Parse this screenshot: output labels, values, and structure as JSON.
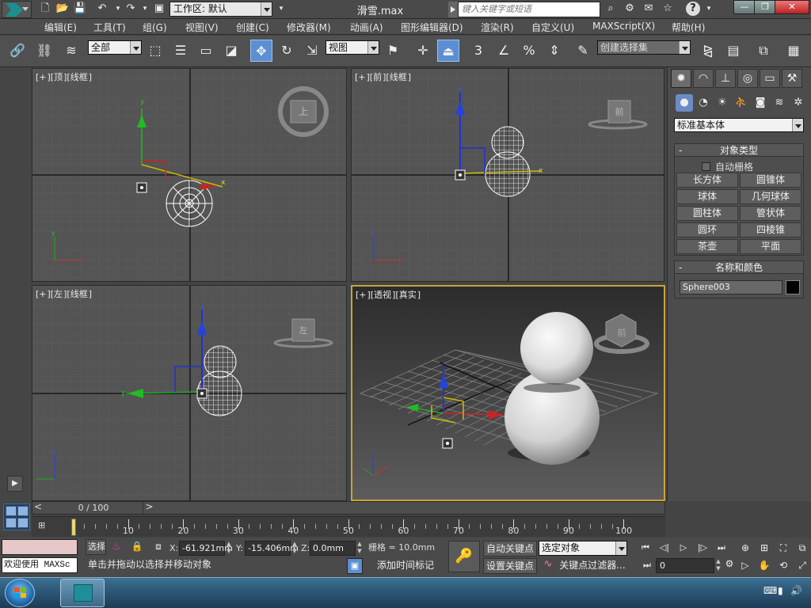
{
  "app": {
    "workspace_label": "工作区: 默认",
    "file_title": "滑雪.max",
    "search_placeholder": "键入关键字或短语",
    "window_controls": {
      "minimize": "—",
      "restore": "❐",
      "close": "✕"
    }
  },
  "menu": {
    "items": [
      "编辑(E)",
      "工具(T)",
      "组(G)",
      "视图(V)",
      "创建(C)",
      "修改器(M)",
      "动画(A)",
      "图形编辑器(D)",
      "渲染(R)",
      "自定义(U)",
      "MAXScript(X)",
      "帮助(H)"
    ]
  },
  "toolbar": {
    "selection_filter": "全部",
    "ref_coord": "视图",
    "named_selection": "创建选择集",
    "snap_labels": {
      "snap": "3",
      "angle": "",
      "percent": "%"
    }
  },
  "viewports": [
    {
      "id": "top",
      "bracket": "+",
      "name": "顶",
      "shading": "线框",
      "viewcube_label": "上"
    },
    {
      "id": "front",
      "bracket": "+",
      "name": "前",
      "shading": "线框",
      "viewcube_label": "前"
    },
    {
      "id": "left",
      "bracket": "+",
      "name": "左",
      "shading": "线框",
      "viewcube_label": "左"
    },
    {
      "id": "persp",
      "bracket": "+",
      "name": "透视",
      "shading": "真实",
      "viewcube_label": "前"
    }
  ],
  "command_panel": {
    "category": "标准基本体",
    "object_type_title": "对象类型",
    "autogrid_label": "自动栅格",
    "object_buttons": [
      "长方体",
      "圆锥体",
      "球体",
      "几何球体",
      "圆柱体",
      "管状体",
      "圆环",
      "四棱锥",
      "茶壶",
      "平面"
    ],
    "name_color_title": "名称和颜色",
    "object_name": "Sphere003",
    "object_color": "#000000",
    "rollout_toggle": "-"
  },
  "timeline": {
    "frame_display": "0 / 100",
    "ticks": [
      "10",
      "20",
      "30",
      "40",
      "50",
      "60",
      "70",
      "80",
      "90",
      "100"
    ]
  },
  "status": {
    "listener_text": "欢迎使用 MAXSc",
    "selection_label": "选择",
    "prompt": "单击并拖动以选择并移动对象",
    "x_label": "X:",
    "x_value": "-61.921mm",
    "y_label": "Y:",
    "y_value": "-15.406mm",
    "z_label": "Z:",
    "z_value": "0.0mm",
    "grid_text": "栅格 = 10.0mm",
    "add_time_tag": "添加时间标记",
    "auto_key": "自动关键点",
    "set_key": "设置关键点",
    "key_mode_select": "选定对象",
    "key_filters": "关键点过滤器...",
    "current_frame": "0"
  },
  "colors": {
    "accent_blue": "#5b8fd1",
    "active_viewport_border": "#c9a33a",
    "max_teal": "#1c8e8f"
  }
}
